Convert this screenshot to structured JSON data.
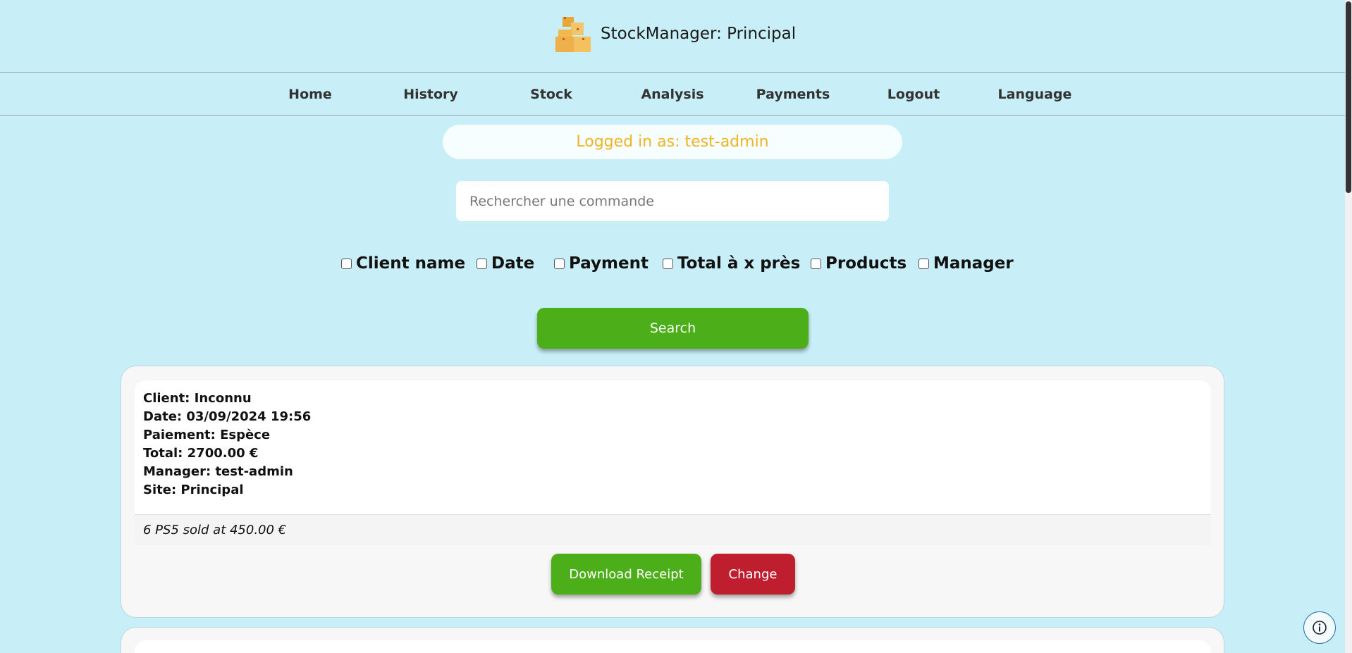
{
  "header": {
    "logo_icon": "boxes-icon",
    "title": "StockManager: Principal"
  },
  "nav": {
    "items": [
      {
        "label": "Home"
      },
      {
        "label": "History"
      },
      {
        "label": "Stock"
      },
      {
        "label": "Analysis"
      },
      {
        "label": "Payments"
      },
      {
        "label": "Logout"
      },
      {
        "label": "Language"
      }
    ]
  },
  "status": {
    "logged_in": "Logged in as: test-admin"
  },
  "search": {
    "placeholder": "Rechercher une commande",
    "value": "",
    "button_label": "Search"
  },
  "filters": [
    {
      "label": "Client name",
      "checked": false
    },
    {
      "label": "Date",
      "checked": false
    },
    {
      "label": "Payment",
      "checked": false
    },
    {
      "label": "Total à x près",
      "checked": false
    },
    {
      "label": "Products",
      "checked": false
    },
    {
      "label": "Manager",
      "checked": false
    }
  ],
  "orders": [
    {
      "client": "Client: Inconnu",
      "date": "Date: 03/09/2024 19:56",
      "payment": "Paiement: Espèce",
      "total": "Total: 2700.00 €",
      "manager": "Manager: test-admin",
      "site": "Site: Principal",
      "products": "6 PS5 sold at 450.00 €",
      "download_label": "Download Receipt",
      "change_label": "Change"
    }
  ],
  "colors": {
    "background": "#c8eff7",
    "accent_green": "#4caf1a",
    "accent_red": "#be1e2d",
    "logged_text": "#f0b323"
  },
  "info_icon": "info-icon"
}
